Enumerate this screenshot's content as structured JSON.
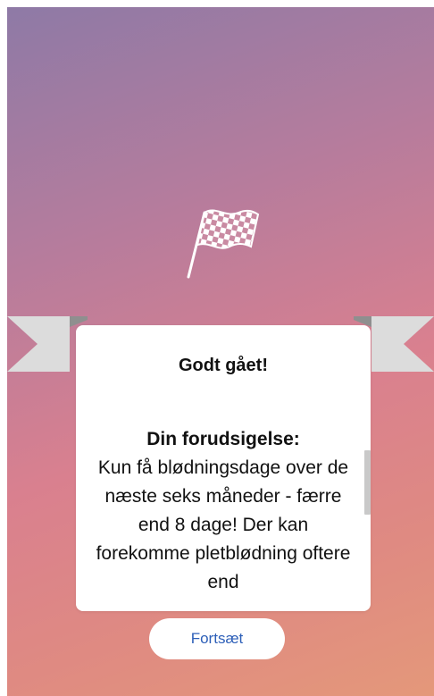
{
  "colors": {
    "gradient_top": "#8e7aa6",
    "gradient_bottom": "#e4987a",
    "button_text": "#2d5fb8",
    "ribbon": "#dcdcdc"
  },
  "icons": {
    "flag": "checkered-flag-icon"
  },
  "card": {
    "title": "Godt gået!",
    "heading": "Din forudsigelse:",
    "text": "Kun få blødningsdage over de næste seks måneder - færre end 8 dage! Der kan forekomme pletblødning oftere end"
  },
  "actions": {
    "continue_label": "Fortsæt"
  }
}
